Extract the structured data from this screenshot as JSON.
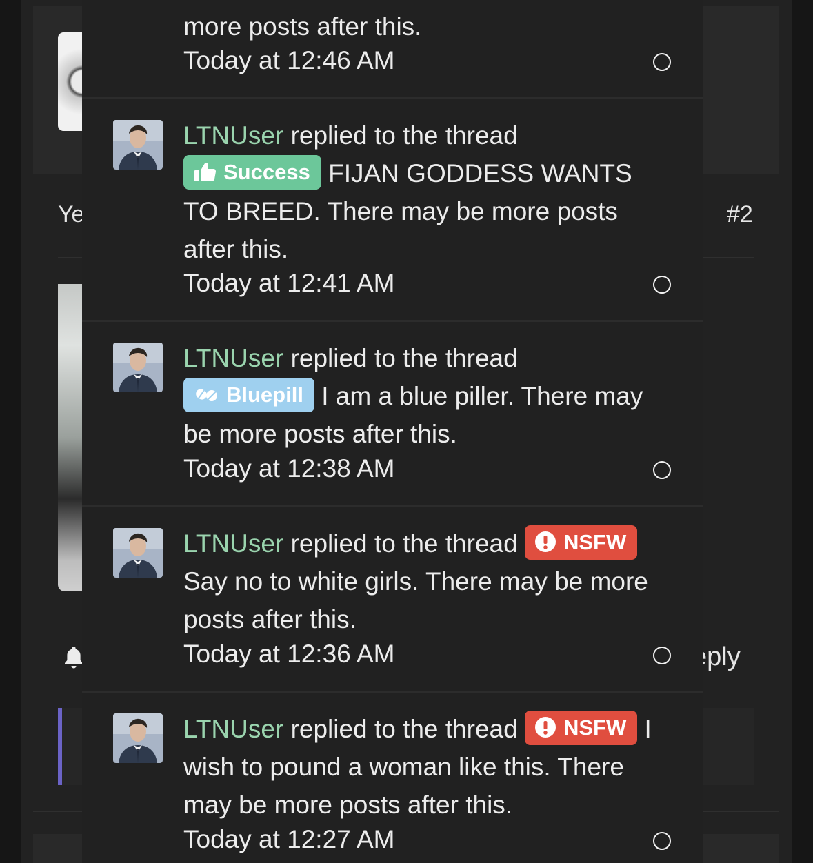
{
  "background": {
    "left_text": "Ye",
    "post_number": "#2",
    "reply_fragment": "eply"
  },
  "colors": {
    "username": "#9ad4ae",
    "success_label": "#6cc79a",
    "bluepill_label": "#9fd0ef",
    "nsfw_label": "#e04e3f",
    "panel_bg": "#212121"
  },
  "alerts": [
    {
      "text_lines": [
        "more posts after this."
      ],
      "time": "Today at 12:46 AM"
    },
    {
      "user": "LTNUser",
      "action": "replied to the thread",
      "label": "Success",
      "label_icon": "thumbs-up-icon",
      "title": "FIJAN GODDESS WANTS TO BREED. There may be more posts after this.",
      "time": "Today at 12:41 AM"
    },
    {
      "user": "LTNUser",
      "action": "replied to the thread",
      "label": "Bluepill",
      "label_icon": "pills-icon",
      "title": "I am a blue piller. There may be more posts after this.",
      "time": "Today at 12:38 AM"
    },
    {
      "user": "LTNUser",
      "action": "replied to the thread",
      "label": "NSFW",
      "label_icon": "exclamation-circle-icon",
      "title": "Say no to white girls. There may be more posts after this.",
      "time": "Today at 12:36 AM"
    },
    {
      "user": "LTNUser",
      "action": "replied to the thread",
      "label": "NSFW",
      "label_icon": "exclamation-circle-icon",
      "title": "I wish to pound a woman like this. There may be more posts after this.",
      "time": "Today at 12:27 AM"
    }
  ]
}
